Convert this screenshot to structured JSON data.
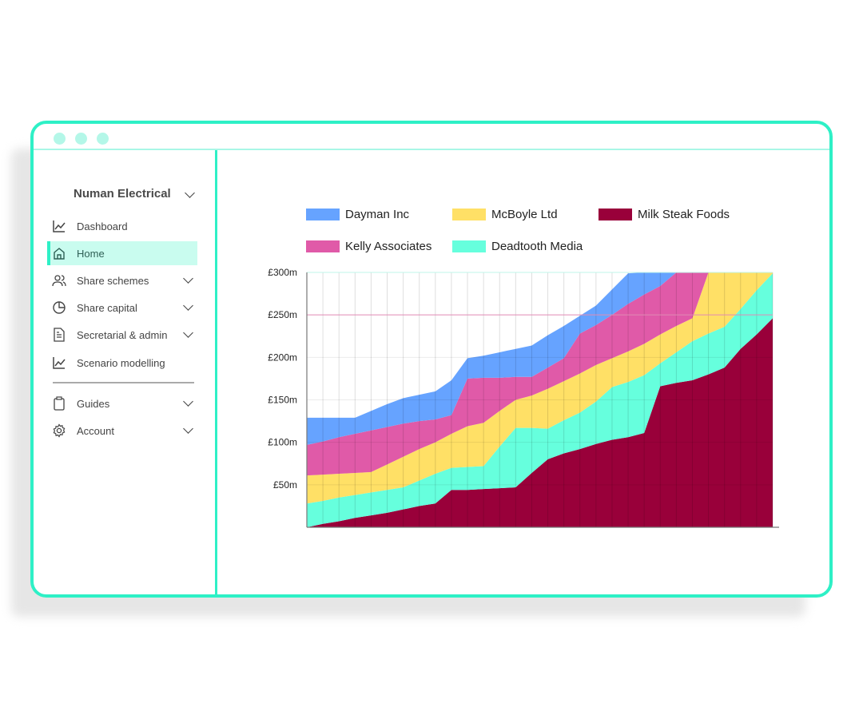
{
  "window": {
    "frame_color": "#2ef0c6",
    "dot_color": "#b4f7e8"
  },
  "sidebar": {
    "company": "Numan Electrical",
    "items": [
      {
        "label": "Dashboard",
        "icon": "line-chart-icon",
        "chevron": false,
        "active": false
      },
      {
        "label": "Home",
        "icon": "home-icon",
        "chevron": false,
        "active": true
      },
      {
        "label": "Share schemes",
        "icon": "users-icon",
        "chevron": true,
        "active": false
      },
      {
        "label": "Share capital",
        "icon": "pie-chart-icon",
        "chevron": true,
        "active": false
      },
      {
        "label": "Secretarial & admin",
        "icon": "document-icon",
        "chevron": true,
        "active": false
      },
      {
        "label": "Scenario modelling",
        "icon": "line-chart-icon",
        "chevron": false,
        "active": false
      }
    ],
    "bottom_items": [
      {
        "label": "Guides",
        "icon": "clipboard-icon",
        "chevron": true
      },
      {
        "label": "Account",
        "icon": "gear-icon",
        "chevron": true
      }
    ]
  },
  "chart_data": {
    "type": "area",
    "stacked": true,
    "title": "",
    "xlabel": "",
    "ylabel": "",
    "ylim": [
      0,
      300
    ],
    "yticks": [
      50,
      100,
      150,
      200,
      250,
      300
    ],
    "ytick_labels": [
      "£50m",
      "£100m",
      "£150m",
      "£200m",
      "£250m",
      "£300m"
    ],
    "highlight_line": 250,
    "grid": true,
    "legend_position": "top",
    "legend": [
      "Dayman Inc",
      "McBoyle Ltd",
      "Milk Steak Foods",
      "Kelly Associates",
      "Deadtooth Media"
    ],
    "series": [
      {
        "name": "Milk Steak Foods",
        "color": "#99003a",
        "values": [
          0,
          4,
          7,
          11,
          14,
          17,
          21,
          25,
          28,
          44,
          44,
          45,
          46,
          47,
          64,
          80,
          87,
          92,
          98,
          103,
          106,
          111,
          166,
          170,
          173,
          180,
          188,
          210,
          227,
          246
        ]
      },
      {
        "name": "Deadtooth Media",
        "color": "#66ffdd",
        "values": [
          28,
          27,
          28,
          27,
          27,
          27,
          26,
          30,
          35,
          26,
          27,
          27,
          49,
          70,
          53,
          36,
          39,
          43,
          50,
          62,
          65,
          68,
          27,
          36,
          46,
          48,
          48,
          47,
          52,
          53
        ]
      },
      {
        "name": "McBoyle Ltd",
        "color": "#ffe066",
        "values": [
          33,
          31,
          28,
          26,
          24,
          30,
          36,
          37,
          37,
          40,
          48,
          51,
          42,
          33,
          38,
          47,
          46,
          46,
          43,
          34,
          36,
          37,
          34,
          31,
          27,
          72,
          74,
          58,
          41,
          21
        ]
      },
      {
        "name": "Kelly Associates",
        "color": "#e05aa8",
        "values": [
          36,
          39,
          43,
          46,
          49,
          44,
          39,
          33,
          27,
          22,
          56,
          53,
          39,
          27,
          22,
          25,
          27,
          47,
          47,
          51,
          56,
          58,
          57,
          63,
          64,
          25,
          20,
          20,
          20,
          25
        ]
      },
      {
        "name": "Dayman Inc",
        "color": "#66a3ff",
        "values": [
          32,
          28,
          23,
          19,
          23,
          27,
          30,
          31,
          33,
          41,
          24,
          26,
          30,
          33,
          37,
          38,
          38,
          21,
          23,
          30,
          36,
          36,
          36,
          30,
          30,
          25,
          25,
          25,
          25,
          25
        ]
      }
    ]
  }
}
